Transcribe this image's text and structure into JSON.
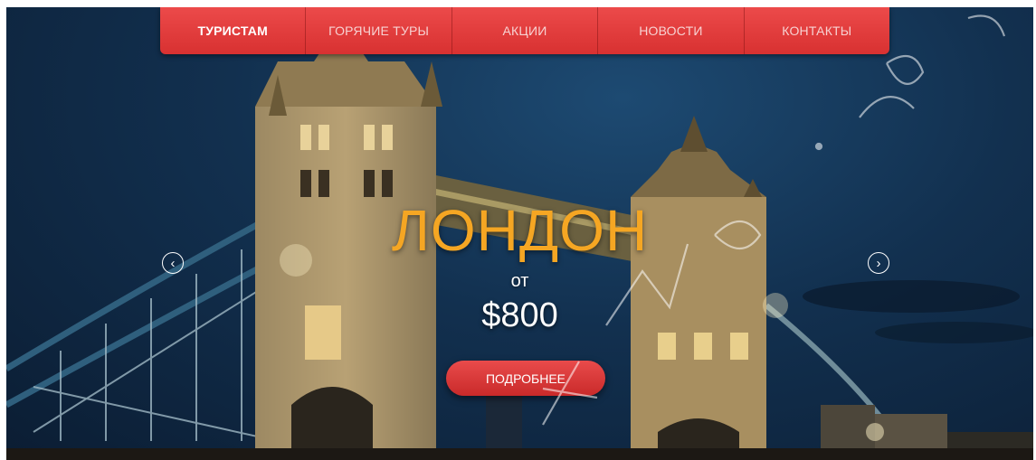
{
  "nav": {
    "items": [
      {
        "label": "ТУРИСТАМ",
        "active": true
      },
      {
        "label": "ГОРЯЧИЕ ТУРЫ",
        "active": false
      },
      {
        "label": "АКЦИИ",
        "active": false
      },
      {
        "label": "НОВОСТИ",
        "active": false
      },
      {
        "label": "КОНТАКТЫ",
        "active": false
      }
    ]
  },
  "slide": {
    "city": "ЛОНДОН",
    "from": "от",
    "price": "$800",
    "button_label": "ПОДРОБНЕЕ"
  },
  "slider": {
    "prev_icon": "chevron-left-icon",
    "next_icon": "chevron-right-icon",
    "prev_glyph": "‹",
    "next_glyph": "›"
  },
  "colors": {
    "nav_red": "#e03a3a",
    "city_orange": "#f5a623",
    "button_red": "#d93535"
  }
}
